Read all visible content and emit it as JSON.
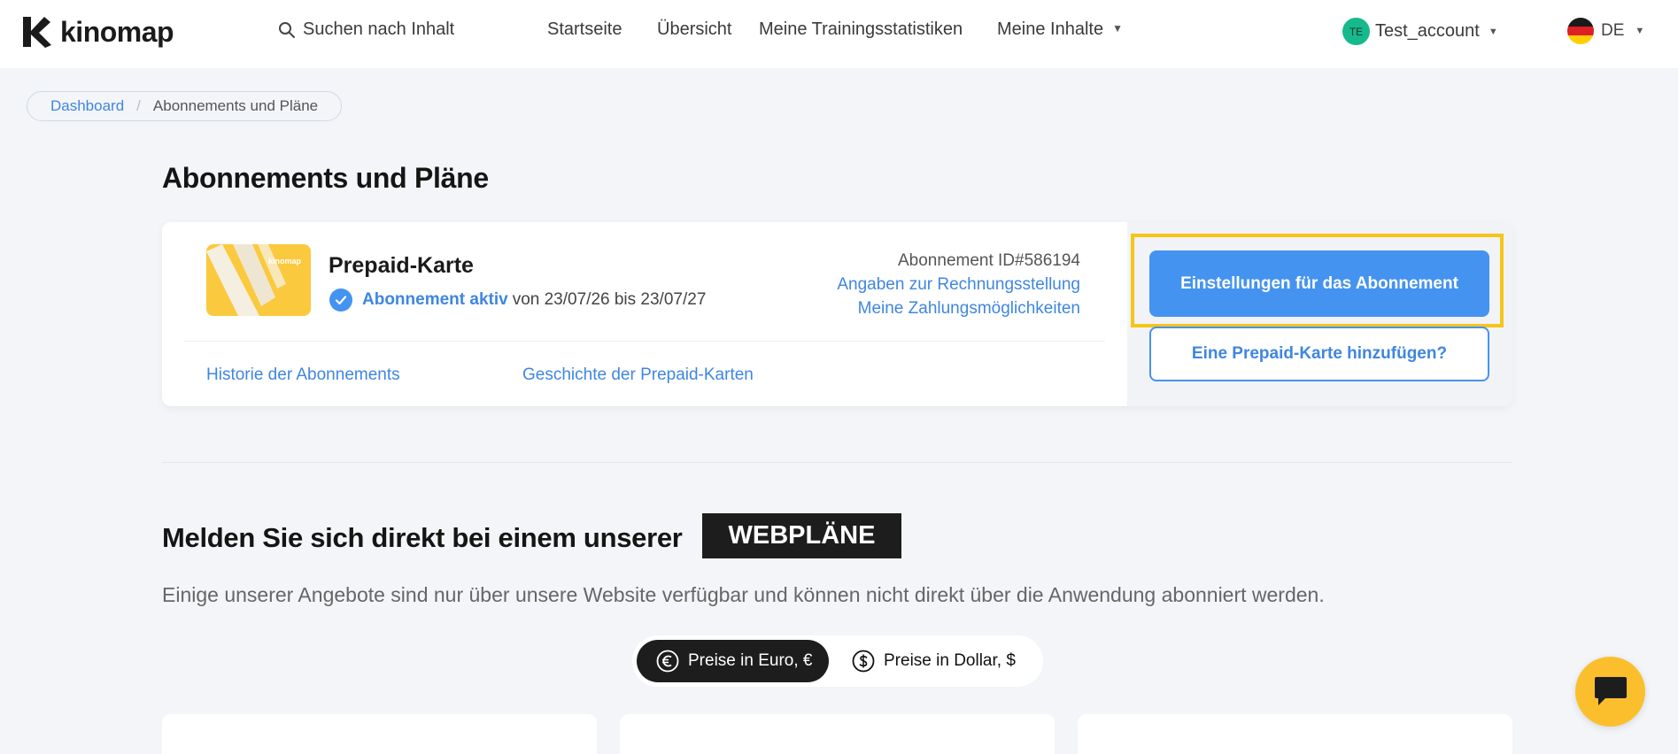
{
  "header": {
    "logo_text": "kinomap",
    "search": {
      "placeholder": "Suchen nach Inhalt"
    },
    "nav": [
      {
        "label": "Startseite"
      },
      {
        "label": "Übersicht"
      },
      {
        "label": "Meine Trainingsstatistiken"
      },
      {
        "label": "Meine Inhalte",
        "has_dropdown": true
      }
    ],
    "account": {
      "initials": "TE",
      "name": "Test_account"
    },
    "language": {
      "code": "DE",
      "flag": "germany"
    }
  },
  "breadcrumb": {
    "items": [
      {
        "label": "Dashboard",
        "link": true
      },
      {
        "label": "Abonnements und Pläne",
        "link": false
      }
    ],
    "separator": "/"
  },
  "page_title": "Abonnements und Pläne",
  "subscription": {
    "plan_name": "Prepaid-Karte",
    "card_brand": "kinomap",
    "status_label": "Abonnement aktiv",
    "status_dates": "von 23/07/26 bis 23/07/27",
    "subscription_id": "Abonnement ID#586194",
    "billing_link": "Angaben zur Rechnungsstellung",
    "payment_link": "Meine Zahlungsmöglichkeiten",
    "history_link": "Historie der Abonnements",
    "prepaid_history_link": "Geschichte der Prepaid-Karten",
    "settings_button": "Einstellungen für das Abonnement",
    "add_prepaid_button": "Eine Prepaid-Karte hinzufügen?"
  },
  "webplans": {
    "title": "Melden Sie sich direkt bei einem unserer",
    "badge": "WEBPLÄNE",
    "description": "Einige unserer Angebote sind nur über unsere Website verfügbar und können nicht direkt über die Anwendung abonniert werden.",
    "currency_options": [
      {
        "label": "Preise in Euro, €",
        "symbol": "€",
        "active": true
      },
      {
        "label": "Preise in Dollar, $",
        "symbol": "$",
        "active": false
      }
    ]
  },
  "colors": {
    "accent_blue": "#4493f0",
    "link_blue": "#3f86e0",
    "highlight_yellow": "#f5c518",
    "chat_yellow": "#fbbf2e",
    "avatar_green": "#16b98b",
    "dark": "#1d1d1d"
  },
  "icons": {
    "search": "search-icon",
    "check": "check-circle-icon",
    "euro": "euro-coin-icon",
    "dollar": "dollar-coin-icon",
    "chat": "chat-bubble-icon"
  }
}
